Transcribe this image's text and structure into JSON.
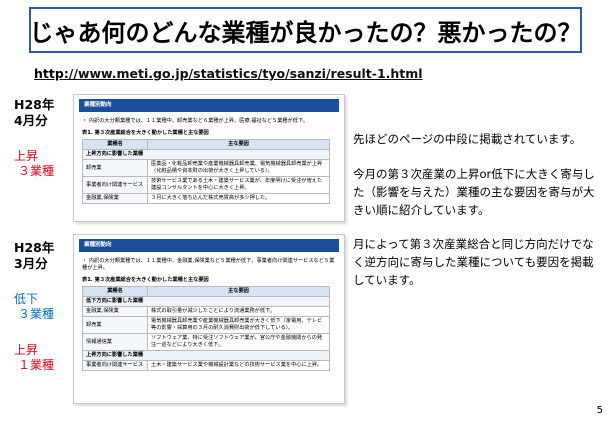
{
  "slide": {
    "title": "じゃあ何のどんな業種が良かったの？悪かったの？",
    "url_proto": "http",
    "url_rest": "://www.meti.go.jp/statistics/tyo/sanzi/result-1.html",
    "page_number": "5"
  },
  "left_labels": {
    "apr_period": "H28年",
    "apr_month": "4月分",
    "apr_up": "上昇",
    "apr_up_count": "３業種",
    "mar_period": "H28年",
    "mar_month": "3月分",
    "mar_down": "低下",
    "mar_down_count": "３業種",
    "mar_up": "上昇",
    "mar_up_count": "１業種"
  },
  "panel_april": {
    "header": "業種別動向",
    "summary": "・ 内訳の大分類業種では、１１業種中、卸売業など６業種が上昇、医療,福祉など５業種が低下。",
    "caption": "表1. 第３次産業総合を大きく動かした業種と主な要因",
    "col_industry": "業種名",
    "col_factor": "主な要因",
    "group_up": "上昇方向に影響した業種",
    "rows": [
      {
        "name": "卸売業",
        "factor": "医薬品・化粧品卸売業や産業機械器具卸売業、電気機械器具卸売業が上昇（化粧品積や資本財の出荷が大きく上昇している）。"
      },
      {
        "name": "事業者向け関連サービス",
        "factor": "技術サービス業である土木・建築サービス業が、年度明けに受注が増えた建設コンサルタントを中心に大きく上昇。"
      },
      {
        "name": "金融業,保険業",
        "factor": "３月に大きく落ち込んだ株式売買高が多少押した。"
      }
    ]
  },
  "panel_march": {
    "header": "業種別動向",
    "summary": "・ 内訳の大分類業種では、１１業種中、金融業,保険業など５業種が低下、事業者向け関連サービスなど５業種が上昇。",
    "caption": "表1. 第３次産業総合を大きく動かした業種と主な要因",
    "col_industry": "業種名",
    "col_factor": "主な要因",
    "group_down": "低下方向に影響した業種",
    "rows_down": [
      {
        "name": "金融業,保険業",
        "factor": "株式の取引量が減少したことにより流通業務が低下。"
      },
      {
        "name": "卸売業",
        "factor": "電気機械器具卸売業や産業機械器具卸売業が大きく低下（家電用、テレビ等の影響・採算用の３月の耐久消費財出荷が低下している）。"
      },
      {
        "name": "情報通信業",
        "factor": "ソフトウェア業、特に受注ソフトウェア業が、官公庁や金融機関からの発注一巡などにより大きく低下。"
      }
    ],
    "group_up": "上昇方向に影響した業種",
    "rows_up": [
      {
        "name": "事業者向け関連サービス",
        "factor": "土木・建築サービス業や機械設計業などの技術サービス業を中心に上昇。"
      }
    ]
  },
  "right_text": {
    "p1": "先ほどのページの中段に掲載されています。",
    "p2": "今月の第３次産業の上昇or低下に大きく寄与した（影響を与えた）業種の主な要因を寄与が大きい順に紹介しています。",
    "p3": "月によって第３次産業総合と同じ方向だけでなく逆方向に寄与した業種についても要因を掲載しています。"
  }
}
